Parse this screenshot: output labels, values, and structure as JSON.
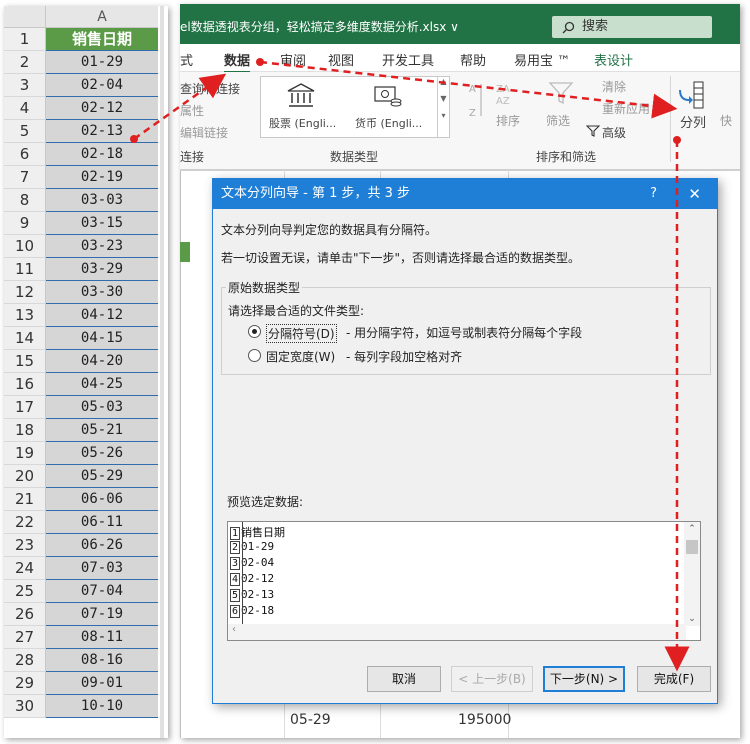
{
  "spreadsheet": {
    "column_letter": "A",
    "header_row_number": "1",
    "header_cell": "销售日期",
    "rows": [
      {
        "num": "2",
        "val": "01-29"
      },
      {
        "num": "3",
        "val": "02-04"
      },
      {
        "num": "4",
        "val": "02-12"
      },
      {
        "num": "5",
        "val": "02-13"
      },
      {
        "num": "6",
        "val": "02-18"
      },
      {
        "num": "7",
        "val": "02-19"
      },
      {
        "num": "8",
        "val": "03-03"
      },
      {
        "num": "9",
        "val": "03-15"
      },
      {
        "num": "10",
        "val": "03-23"
      },
      {
        "num": "11",
        "val": "03-29"
      },
      {
        "num": "12",
        "val": "03-30"
      },
      {
        "num": "13",
        "val": "04-12"
      },
      {
        "num": "14",
        "val": "04-15"
      },
      {
        "num": "15",
        "val": "04-20"
      },
      {
        "num": "16",
        "val": "04-25"
      },
      {
        "num": "17",
        "val": "05-03"
      },
      {
        "num": "18",
        "val": "05-21"
      },
      {
        "num": "19",
        "val": "05-26"
      },
      {
        "num": "20",
        "val": "05-29"
      },
      {
        "num": "21",
        "val": "06-06"
      },
      {
        "num": "22",
        "val": "06-11"
      },
      {
        "num": "23",
        "val": "06-26"
      },
      {
        "num": "24",
        "val": "07-03"
      },
      {
        "num": "25",
        "val": "07-04"
      },
      {
        "num": "26",
        "val": "07-19"
      },
      {
        "num": "27",
        "val": "08-11"
      },
      {
        "num": "28",
        "val": "08-16"
      },
      {
        "num": "29",
        "val": "09-01"
      },
      {
        "num": "30",
        "val": "10-10"
      }
    ]
  },
  "excel": {
    "filename": "el数据透视表分组，轻松搞定多维度数据分析.xlsx ∨",
    "search_placeholder": "搜索",
    "tabs": [
      "式",
      "数据",
      "审阅",
      "视图",
      "开发工具",
      "帮助",
      "易用宝 ™",
      "表设计"
    ],
    "ribbon": {
      "conn_line1": "查询和连接",
      "conn_line2": "属性",
      "conn_line3": "编辑链接",
      "conn_group": "连接",
      "stock_label": "股票 (Engli...",
      "currency_label": "货币 (Engli...",
      "datatype_group": "数据类型",
      "sort_label": "排序",
      "filter_label": "筛选",
      "clear_label": "清除",
      "reapply_label": "重新应用",
      "advanced_label": "高级",
      "sortfilter_group": "排序和筛选",
      "split_label": "分列",
      "quick_label": "快"
    },
    "bottom_cell_date": "05-29",
    "bottom_cell_value": "195000"
  },
  "dialog": {
    "title": "文本分列向导 - 第 1 步，共 3 步",
    "help": "?",
    "close": "✕",
    "line1": "文本分列向导判定您的数据具有分隔符。",
    "line2": "若一切设置无误，请单击\"下一步\"，否则请选择最合适的数据类型。",
    "group_label": "原始数据类型",
    "choose_label": "请选择最合适的文件类型:",
    "opt1_label": "分隔符号(D)",
    "opt1_desc": "- 用分隔字符，如逗号或制表符分隔每个字段",
    "opt2_label": "固定宽度(W)",
    "opt2_desc": "- 每列字段加空格对齐",
    "preview_label": "预览选定数据:",
    "preview_lines": [
      {
        "n": "1",
        "t": "销售日期"
      },
      {
        "n": "2",
        "t": "01-29"
      },
      {
        "n": "3",
        "t": "02-04"
      },
      {
        "n": "4",
        "t": "02-12"
      },
      {
        "n": "5",
        "t": "02-13"
      },
      {
        "n": "6",
        "t": "02-18"
      }
    ],
    "btn_cancel": "取消",
    "btn_prev": "< 上一步(B)",
    "btn_next": "下一步(N) >",
    "btn_finish": "完成(F)"
  },
  "colors": {
    "excel_green": "#217346",
    "header_green": "#5b9b47",
    "dialog_blue": "#1f7fd6",
    "arrow_red": "#e02020"
  }
}
